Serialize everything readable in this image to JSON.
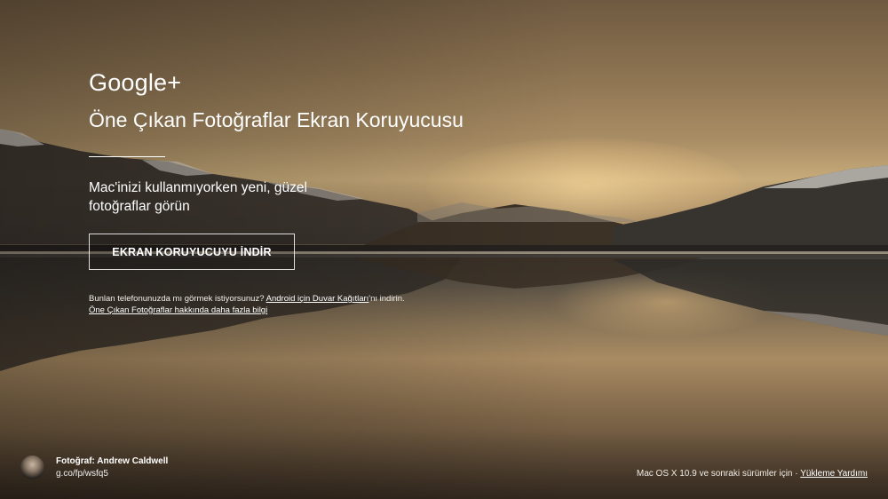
{
  "header": {
    "logo_text": "Google+",
    "title": "Öne Çıkan Fotoğraflar Ekran Koruyucusu",
    "subtitle": "Mac'inizi kullanmıyorken yeni, güzel fotoğraflar görün"
  },
  "download": {
    "button_label": "EKRAN KORUYUCUYU İNDİR"
  },
  "phone": {
    "prefix": "Bunlan telefonunuzda mı görmek istiyorsunuz?",
    "link": "Android için Duvar Kağıtları",
    "suffix": "'nı indirin.",
    "more_link": "Öne Çıkan Fotoğraflar hakkında daha fazla bilgi"
  },
  "credit": {
    "photographer": "Fotoğraf: Andrew Caldwell",
    "short_link": "g.co/fp/wsfq5"
  },
  "footer": {
    "os_text": "Mac OS X 10.9 ve sonraki sürümler için ·",
    "help_link": "Yükleme Yardımı"
  },
  "icons": {
    "avatar": "photographer-avatar"
  }
}
